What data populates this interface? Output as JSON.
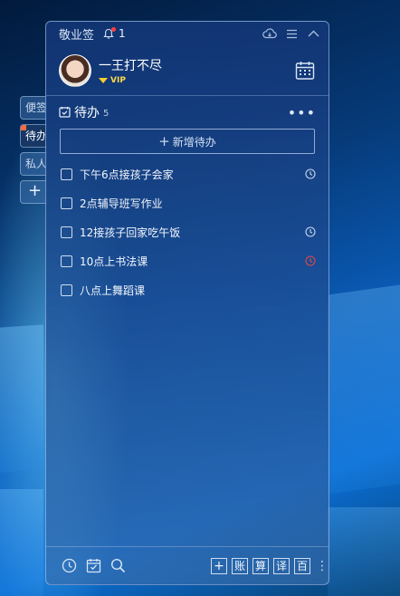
{
  "side_tabs": [
    {
      "label": "便签",
      "active": false
    },
    {
      "label": "待办",
      "active": true
    },
    {
      "label": "私人",
      "active": false
    },
    {
      "label": "+",
      "active": false
    }
  ],
  "titlebar": {
    "app_name": "敬业签",
    "notification_count": "1",
    "icons": [
      "cloud-sync-icon",
      "menu-icon",
      "collapse-icon"
    ]
  },
  "user": {
    "name": "一王打不尽",
    "badge": "VIP"
  },
  "section": {
    "title": "待办",
    "count": "5",
    "more_label": "•••",
    "add_label": "新增待办",
    "add_icon": "+"
  },
  "todos": [
    {
      "text": "下午6点接孩子会家",
      "checked": false,
      "reminder": "clock-icon",
      "reminder_color": "#c9d6ea"
    },
    {
      "text": "2点辅导班写作业",
      "checked": false,
      "reminder": "",
      "reminder_color": ""
    },
    {
      "text": "12接孩子回家吃午饭",
      "checked": false,
      "reminder": "clock-icon",
      "reminder_color": "#c9d6ea"
    },
    {
      "text": "10点上书法课",
      "checked": false,
      "reminder": "clock-icon",
      "reminder_color": "#e04848"
    },
    {
      "text": "八点上舞蹈课",
      "checked": false,
      "reminder": "",
      "reminder_color": ""
    }
  ],
  "footer": {
    "left_icons": [
      "clock-icon",
      "calendar-check-icon",
      "search-icon"
    ],
    "tools": [
      "+",
      "账",
      "算",
      "译",
      "百"
    ],
    "more": "⋮"
  },
  "colors": {
    "accent_red": "#ff4040",
    "vip_gold": "#ffcf2e",
    "panel_blue": "#143778"
  }
}
